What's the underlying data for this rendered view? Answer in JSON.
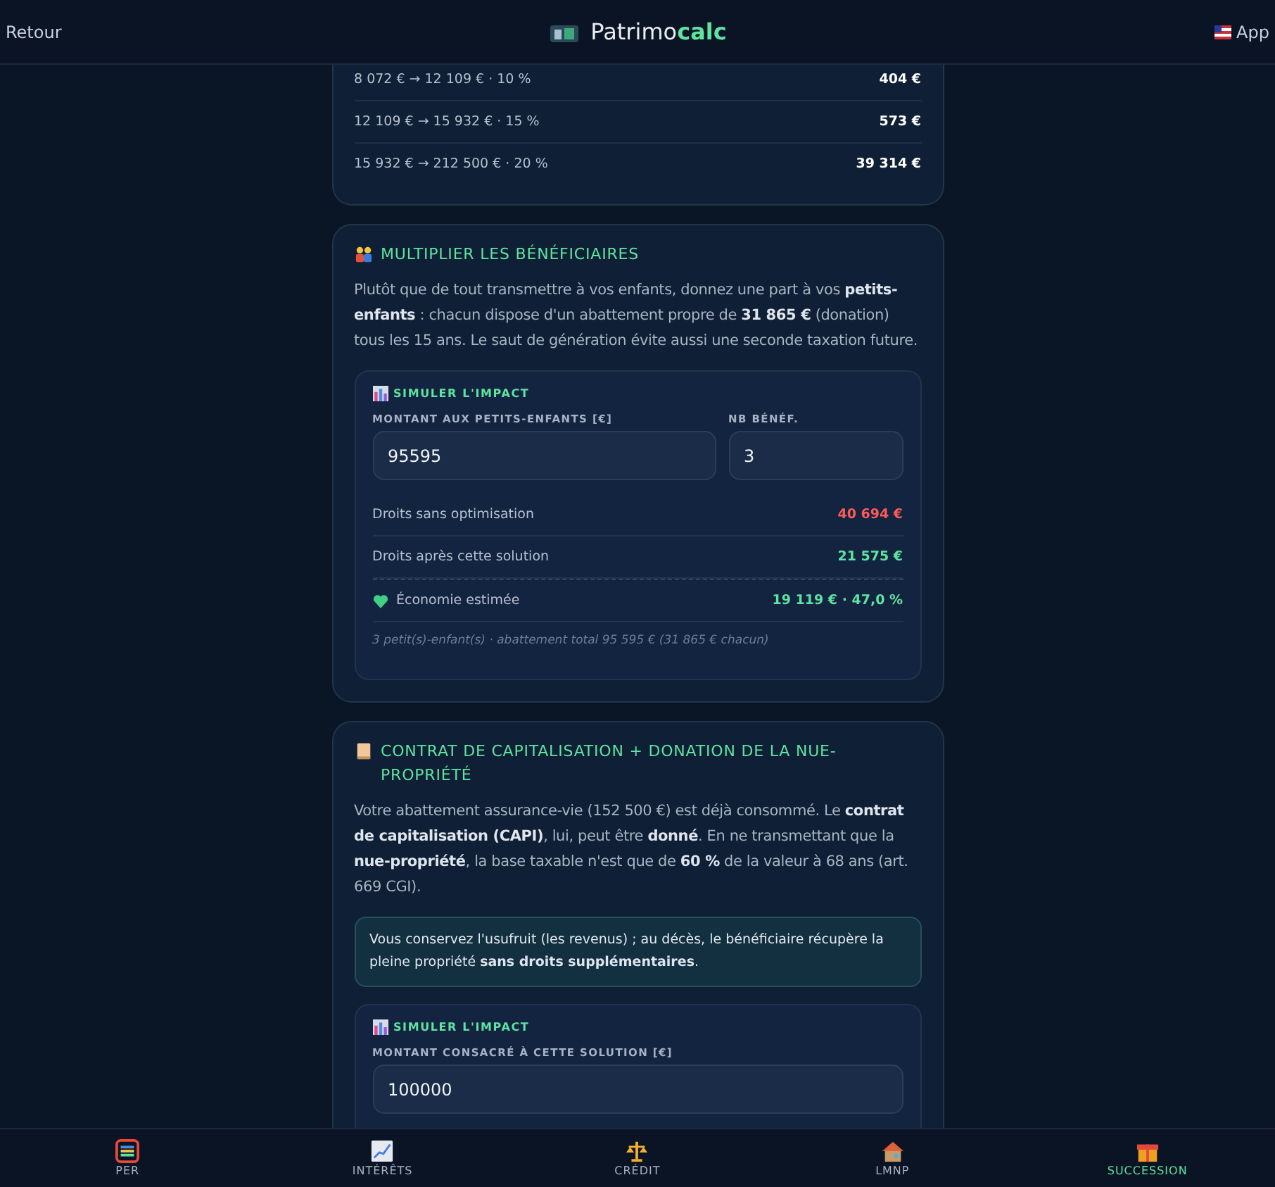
{
  "header": {
    "back": "Retour",
    "logo_main": "Patrimo",
    "logo_accent": "calc",
    "app": "App"
  },
  "brackets": [
    {
      "range": "8 072 € → 12 109 € · 10 %",
      "amount": "404 €"
    },
    {
      "range": "12 109 € → 15 932 € · 15 %",
      "amount": "573 €"
    },
    {
      "range": "15 932 € → 212 500 € · 20 %",
      "amount": "39 314 €"
    }
  ],
  "solutions": [
    {
      "kind": "people",
      "title": "MULTIPLIER LES BÉNÉFICIAIRES",
      "text": "Plutôt que de tout transmettre à vos enfants, donnez une part à vos **petits-enfants** : chacun dispose d'un abattement propre de **31 865 €** (donation) tous les 15 ans. Le saut de génération évite aussi une seconde taxation future.",
      "simulation": {
        "title": "SIMULER L'IMPACT",
        "fields": [
          {
            "label": "MONTANT AUX PETITS-ENFANTS [€]",
            "value": "95595"
          },
          {
            "label": "NB BÉNÉF.",
            "value": "3"
          }
        ],
        "results": [
          {
            "kind": "before",
            "label": "Droits sans optimisation",
            "value": "40 694 €"
          },
          {
            "kind": "after",
            "label": "Droits après cette solution",
            "value": "21 575 €"
          },
          {
            "kind": "saving",
            "label": "Économie estimée",
            "value": "19 119 € · 47,0 %"
          }
        ],
        "note": "3 petit(s)-enfant(s) · abattement total 95 595 € (31 865 € chacun)"
      }
    },
    {
      "kind": "scroll",
      "title": "CONTRAT DE CAPITALISATION + DONATION DE LA NUE-PROPRIÉTÉ",
      "text": "Votre abattement assurance-vie (152 500 €) est déjà consommé. Le **contrat de capitalisation (CAPI)**, lui, peut être **donné**. En ne transmettant que la **nue-propriété**, la base taxable n'est que de **60 %** de la valeur à 68 ans (art. 669 CGI).",
      "info": "Vous conservez l'usufruit (les revenus) ; au décès, le bénéficiaire récupère la pleine propriété **sans droits supplémentaires**.",
      "simulation": {
        "title": "SIMULER L'IMPACT",
        "fields": [
          {
            "label": "MONTANT CONSACRÉ À CETTE SOLUTION [€]",
            "value": "100000"
          }
        ]
      }
    }
  ],
  "nav": [
    {
      "kind": "abacus",
      "label": "PER",
      "selected": false
    },
    {
      "kind": "chart",
      "label": "INTÉRÊTS",
      "selected": false
    },
    {
      "kind": "scales",
      "label": "CRÉDIT",
      "selected": false
    },
    {
      "kind": "house",
      "label": "LMNP",
      "selected": false
    },
    {
      "kind": "gift",
      "label": "SUCCESSION",
      "selected": true
    }
  ]
}
